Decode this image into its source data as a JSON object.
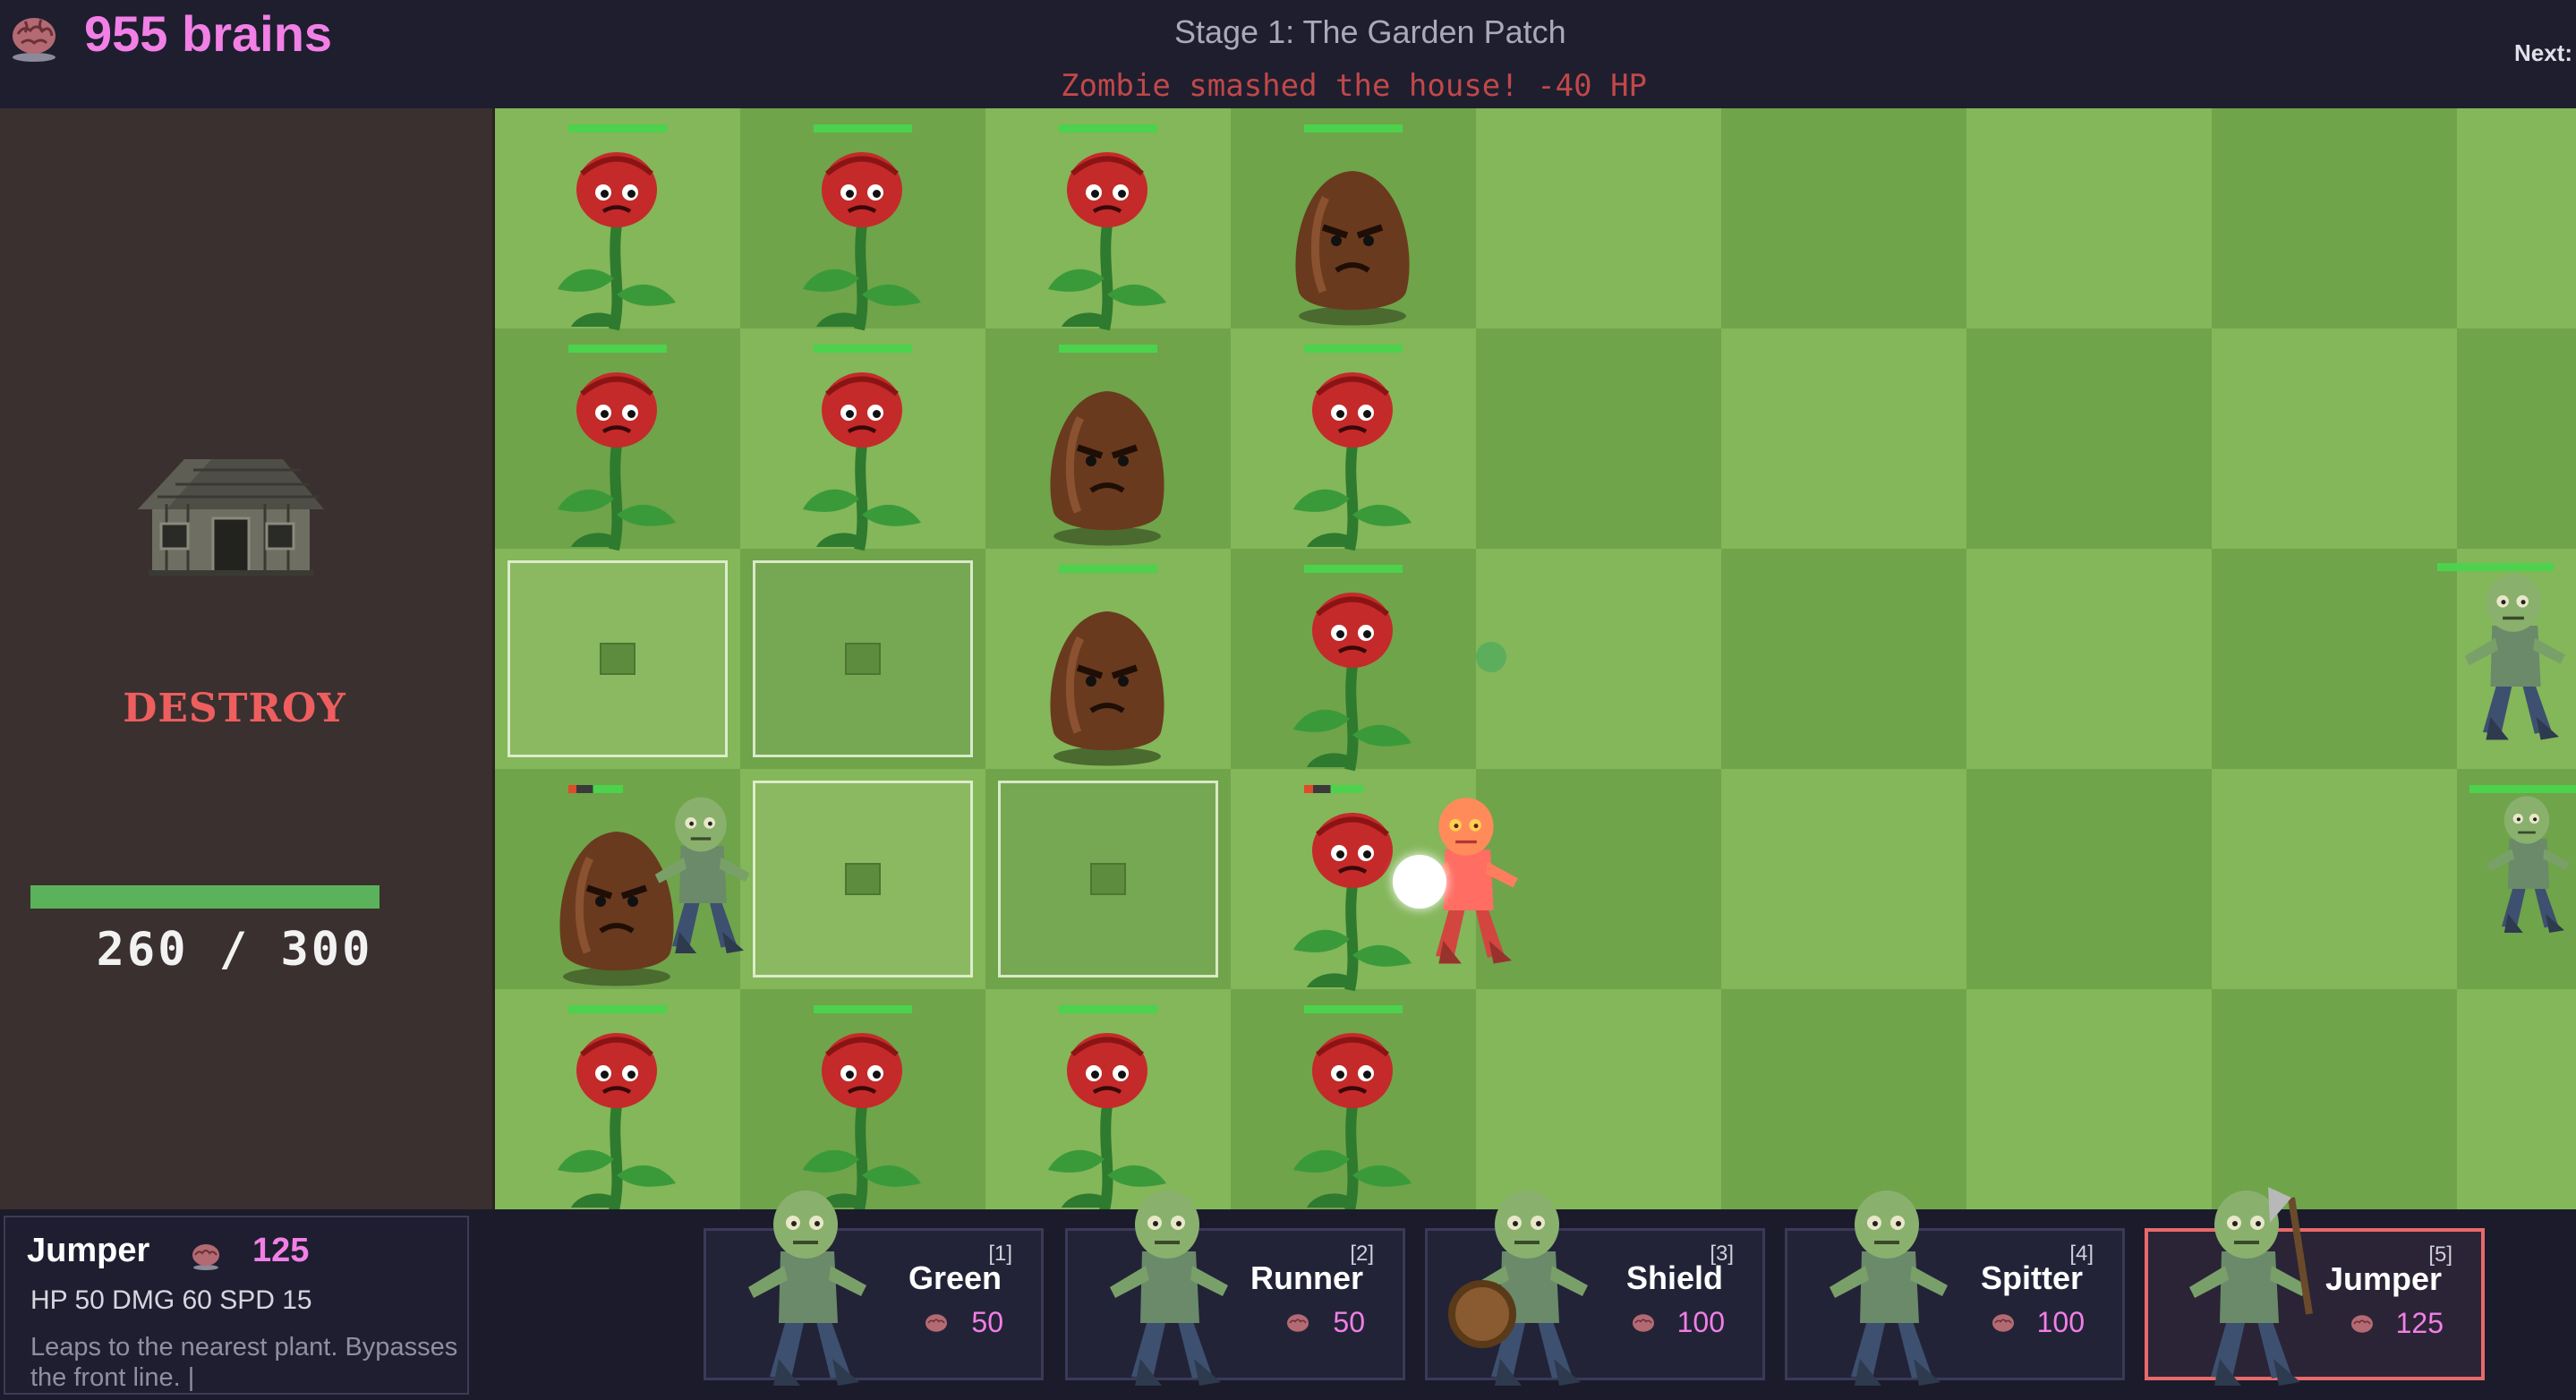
{
  "top": {
    "brains_label": "955 brains",
    "stage": "Stage 1: The Garden Patch",
    "next_label": "Next:",
    "message": "Zombie smashed the house! -40 HP"
  },
  "house": {
    "action_label": "DESTROY",
    "hp_text": "260 / 300",
    "hp_current": 260,
    "hp_max": 300
  },
  "board": {
    "rows": 5,
    "cols": 9,
    "units": [
      {
        "row": 0,
        "col": 0,
        "kind": "rose",
        "health_fraction": 1.0
      },
      {
        "row": 0,
        "col": 1,
        "kind": "rose",
        "health_fraction": 1.0
      },
      {
        "row": 0,
        "col": 2,
        "kind": "rose",
        "health_fraction": 1.0
      },
      {
        "row": 0,
        "col": 3,
        "kind": "seed",
        "health_fraction": 1.0
      },
      {
        "row": 1,
        "col": 0,
        "kind": "rose",
        "health_fraction": 1.0
      },
      {
        "row": 1,
        "col": 1,
        "kind": "rose",
        "health_fraction": 1.0
      },
      {
        "row": 1,
        "col": 2,
        "kind": "seed",
        "health_fraction": 1.0
      },
      {
        "row": 1,
        "col": 3,
        "kind": "rose",
        "health_fraction": 1.0
      },
      {
        "row": 2,
        "col": 2,
        "kind": "seed",
        "health_fraction": 1.0
      },
      {
        "row": 2,
        "col": 3,
        "kind": "rose",
        "health_fraction": 1.0
      },
      {
        "row": 3,
        "col": 0,
        "kind": "seed",
        "health_fraction": 0.55
      },
      {
        "row": 3,
        "col": 3,
        "kind": "rose",
        "health_fraction": 0.6
      },
      {
        "row": 4,
        "col": 0,
        "kind": "rose",
        "health_fraction": 1.0
      },
      {
        "row": 4,
        "col": 1,
        "kind": "rose",
        "health_fraction": 1.0
      },
      {
        "row": 4,
        "col": 2,
        "kind": "rose",
        "health_fraction": 1.0
      },
      {
        "row": 4,
        "col": 3,
        "kind": "rose",
        "health_fraction": 1.0
      }
    ],
    "empty_slots": [
      {
        "row": 2,
        "col": 0
      },
      {
        "row": 2,
        "col": 1
      },
      {
        "row": 3,
        "col": 1
      },
      {
        "row": 3,
        "col": 2
      }
    ]
  },
  "selected": {
    "name": "Jumper",
    "cost": "125",
    "stats": "HP 50 DMG 60 SPD 15",
    "description": "Leaps to the nearest plant. Bypasses the front line. |"
  },
  "cards": [
    {
      "key": "[1]",
      "name": "Green",
      "cost": "50",
      "selected": false
    },
    {
      "key": "[2]",
      "name": "Runner",
      "cost": "50",
      "selected": false
    },
    {
      "key": "[3]",
      "name": "Shield",
      "cost": "100",
      "selected": false
    },
    {
      "key": "[4]",
      "name": "Spitter",
      "cost": "100",
      "selected": false
    },
    {
      "key": "[5]",
      "name": "Jumper",
      "cost": "125",
      "selected": true
    }
  ],
  "colors": {
    "brains": "#f27fe6",
    "destroy": "#ee5e5e",
    "grass_light": "#84b65a",
    "grass_dark": "#6fa44a",
    "health": "#4cd24c",
    "selected_border": "#e86a6a"
  },
  "icons": [
    "brain-icon",
    "house-icon",
    "rose-plant-icon",
    "seed-plant-icon",
    "zombie-icon"
  ]
}
